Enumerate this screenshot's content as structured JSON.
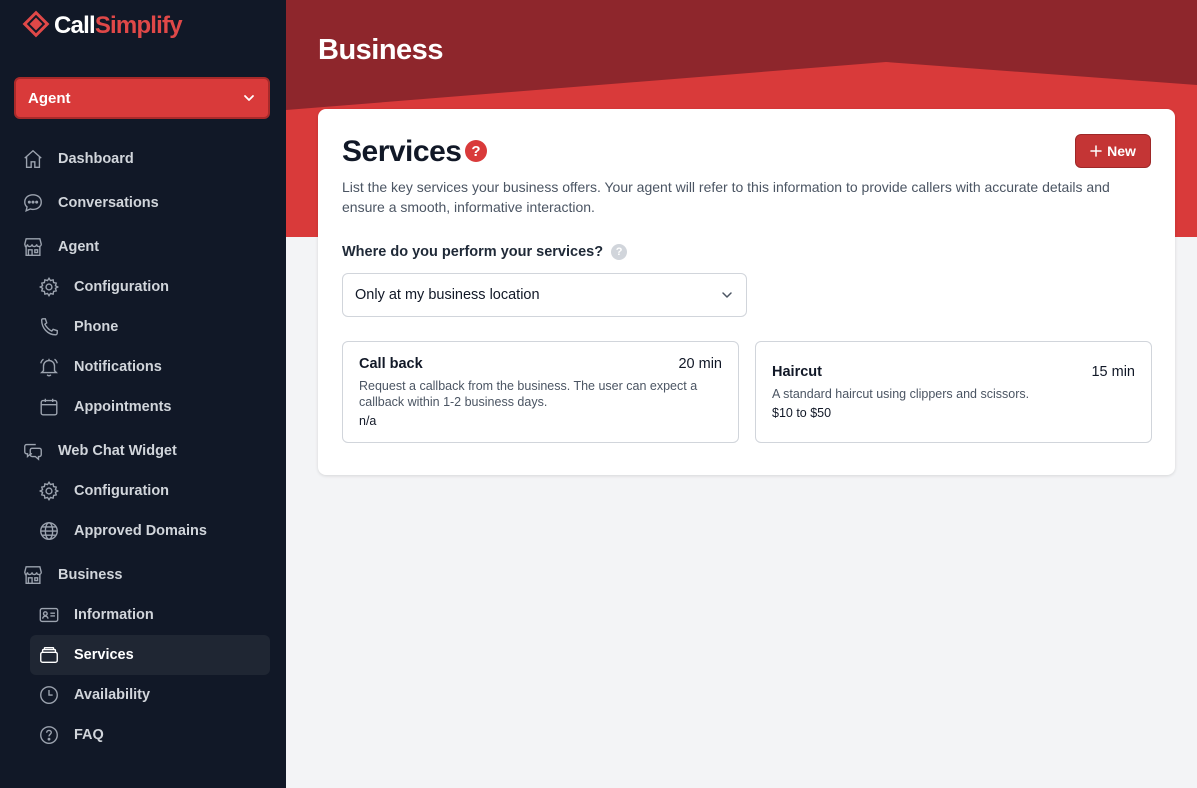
{
  "brand": {
    "name_part1": "Call",
    "name_part2": "Simplify",
    "accent": "#d93a3a"
  },
  "sidebar": {
    "agent_select": "Agent",
    "items": [
      {
        "label": "Dashboard",
        "icon": "home-icon"
      },
      {
        "label": "Conversations",
        "icon": "chat-icon"
      },
      {
        "label": "Agent",
        "icon": "store-icon"
      },
      {
        "label": "Configuration",
        "icon": "gear-icon"
      },
      {
        "label": "Phone",
        "icon": "phone-icon"
      },
      {
        "label": "Notifications",
        "icon": "bell-icon"
      },
      {
        "label": "Appointments",
        "icon": "calendar-icon"
      },
      {
        "label": "Web Chat Widget",
        "icon": "chat-bubbles-icon"
      },
      {
        "label": "Configuration",
        "icon": "gear-icon"
      },
      {
        "label": "Approved Domains",
        "icon": "globe-icon"
      },
      {
        "label": "Business",
        "icon": "store-icon"
      },
      {
        "label": "Information",
        "icon": "id-card-icon"
      },
      {
        "label": "Services",
        "icon": "services-icon"
      },
      {
        "label": "Availability",
        "icon": "clock-icon"
      },
      {
        "label": "FAQ",
        "icon": "question-circle-icon"
      }
    ]
  },
  "header": {
    "title": "Business"
  },
  "card": {
    "title": "Services",
    "help_glyph": "?",
    "new_button": "New",
    "description": "List the key services your business offers. Your agent will refer to this information to provide callers with accurate details and ensure a smooth, informative interaction.",
    "question": "Where do you perform your services?",
    "question_help_glyph": "?",
    "location_select": "Only at my business location",
    "services": [
      {
        "name": "Call back",
        "duration": "20 min",
        "description": "Request a callback from the business. The user can expect a callback within 1-2 business days.",
        "price": "n/a"
      },
      {
        "name": "Haircut",
        "duration": "15 min",
        "description": "A standard haircut using clippers and scissors.",
        "price": "$10 to $50"
      }
    ]
  }
}
